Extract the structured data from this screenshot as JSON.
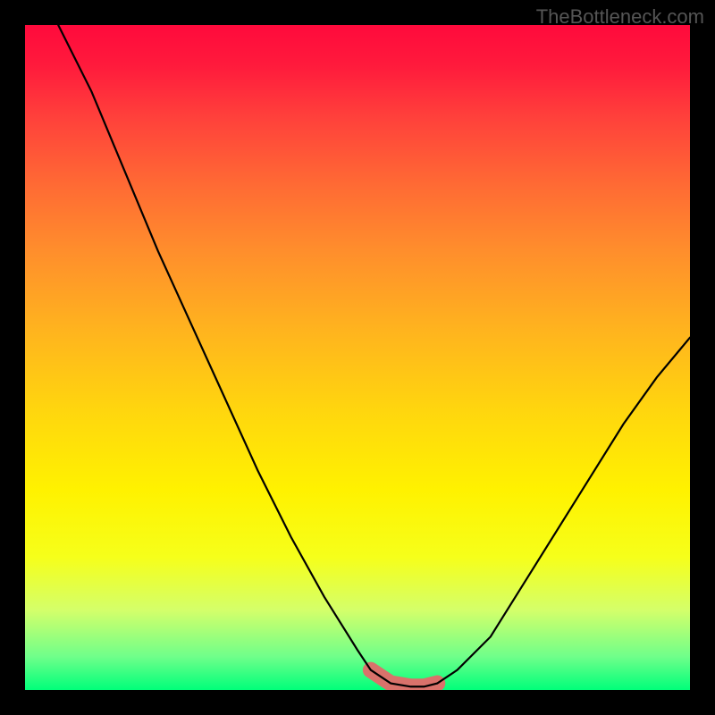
{
  "watermark": "TheBottleneck.com",
  "chart_data": {
    "type": "line",
    "title": "",
    "xlabel": "",
    "ylabel": "",
    "xlim": [
      0,
      100
    ],
    "ylim": [
      0,
      100
    ],
    "series": [
      {
        "name": "curve",
        "x": [
          5,
          10,
          15,
          20,
          25,
          30,
          35,
          40,
          45,
          50,
          52,
          55,
          58,
          60,
          62,
          65,
          70,
          75,
          80,
          85,
          90,
          95,
          100
        ],
        "y": [
          100,
          90,
          78,
          66,
          55,
          44,
          33,
          23,
          14,
          6,
          3,
          1,
          0.5,
          0.5,
          1,
          3,
          8,
          16,
          24,
          32,
          40,
          47,
          53
        ]
      }
    ],
    "highlight_range_x": [
      52,
      64
    ],
    "gradient_colors": {
      "top": "#ff0a3c",
      "mid": "#fff200",
      "bottom": "#00ff7a"
    },
    "highlight_color": "#d9726b"
  }
}
